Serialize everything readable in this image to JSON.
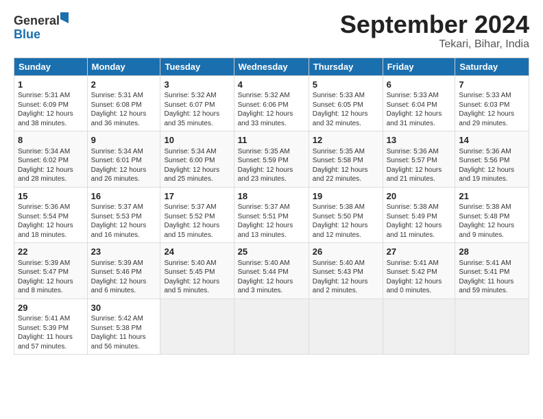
{
  "header": {
    "logo_general": "General",
    "logo_blue": "Blue",
    "title": "September 2024",
    "subtitle": "Tekari, Bihar, India"
  },
  "days_of_week": [
    "Sunday",
    "Monday",
    "Tuesday",
    "Wednesday",
    "Thursday",
    "Friday",
    "Saturday"
  ],
  "weeks": [
    [
      {
        "day": "1",
        "sunrise": "Sunrise: 5:31 AM",
        "sunset": "Sunset: 6:09 PM",
        "daylight": "Daylight: 12 hours and 38 minutes."
      },
      {
        "day": "2",
        "sunrise": "Sunrise: 5:31 AM",
        "sunset": "Sunset: 6:08 PM",
        "daylight": "Daylight: 12 hours and 36 minutes."
      },
      {
        "day": "3",
        "sunrise": "Sunrise: 5:32 AM",
        "sunset": "Sunset: 6:07 PM",
        "daylight": "Daylight: 12 hours and 35 minutes."
      },
      {
        "day": "4",
        "sunrise": "Sunrise: 5:32 AM",
        "sunset": "Sunset: 6:06 PM",
        "daylight": "Daylight: 12 hours and 33 minutes."
      },
      {
        "day": "5",
        "sunrise": "Sunrise: 5:33 AM",
        "sunset": "Sunset: 6:05 PM",
        "daylight": "Daylight: 12 hours and 32 minutes."
      },
      {
        "day": "6",
        "sunrise": "Sunrise: 5:33 AM",
        "sunset": "Sunset: 6:04 PM",
        "daylight": "Daylight: 12 hours and 31 minutes."
      },
      {
        "day": "7",
        "sunrise": "Sunrise: 5:33 AM",
        "sunset": "Sunset: 6:03 PM",
        "daylight": "Daylight: 12 hours and 29 minutes."
      }
    ],
    [
      {
        "day": "8",
        "sunrise": "Sunrise: 5:34 AM",
        "sunset": "Sunset: 6:02 PM",
        "daylight": "Daylight: 12 hours and 28 minutes."
      },
      {
        "day": "9",
        "sunrise": "Sunrise: 5:34 AM",
        "sunset": "Sunset: 6:01 PM",
        "daylight": "Daylight: 12 hours and 26 minutes."
      },
      {
        "day": "10",
        "sunrise": "Sunrise: 5:34 AM",
        "sunset": "Sunset: 6:00 PM",
        "daylight": "Daylight: 12 hours and 25 minutes."
      },
      {
        "day": "11",
        "sunrise": "Sunrise: 5:35 AM",
        "sunset": "Sunset: 5:59 PM",
        "daylight": "Daylight: 12 hours and 23 minutes."
      },
      {
        "day": "12",
        "sunrise": "Sunrise: 5:35 AM",
        "sunset": "Sunset: 5:58 PM",
        "daylight": "Daylight: 12 hours and 22 minutes."
      },
      {
        "day": "13",
        "sunrise": "Sunrise: 5:36 AM",
        "sunset": "Sunset: 5:57 PM",
        "daylight": "Daylight: 12 hours and 21 minutes."
      },
      {
        "day": "14",
        "sunrise": "Sunrise: 5:36 AM",
        "sunset": "Sunset: 5:56 PM",
        "daylight": "Daylight: 12 hours and 19 minutes."
      }
    ],
    [
      {
        "day": "15",
        "sunrise": "Sunrise: 5:36 AM",
        "sunset": "Sunset: 5:54 PM",
        "daylight": "Daylight: 12 hours and 18 minutes."
      },
      {
        "day": "16",
        "sunrise": "Sunrise: 5:37 AM",
        "sunset": "Sunset: 5:53 PM",
        "daylight": "Daylight: 12 hours and 16 minutes."
      },
      {
        "day": "17",
        "sunrise": "Sunrise: 5:37 AM",
        "sunset": "Sunset: 5:52 PM",
        "daylight": "Daylight: 12 hours and 15 minutes."
      },
      {
        "day": "18",
        "sunrise": "Sunrise: 5:37 AM",
        "sunset": "Sunset: 5:51 PM",
        "daylight": "Daylight: 12 hours and 13 minutes."
      },
      {
        "day": "19",
        "sunrise": "Sunrise: 5:38 AM",
        "sunset": "Sunset: 5:50 PM",
        "daylight": "Daylight: 12 hours and 12 minutes."
      },
      {
        "day": "20",
        "sunrise": "Sunrise: 5:38 AM",
        "sunset": "Sunset: 5:49 PM",
        "daylight": "Daylight: 12 hours and 11 minutes."
      },
      {
        "day": "21",
        "sunrise": "Sunrise: 5:38 AM",
        "sunset": "Sunset: 5:48 PM",
        "daylight": "Daylight: 12 hours and 9 minutes."
      }
    ],
    [
      {
        "day": "22",
        "sunrise": "Sunrise: 5:39 AM",
        "sunset": "Sunset: 5:47 PM",
        "daylight": "Daylight: 12 hours and 8 minutes."
      },
      {
        "day": "23",
        "sunrise": "Sunrise: 5:39 AM",
        "sunset": "Sunset: 5:46 PM",
        "daylight": "Daylight: 12 hours and 6 minutes."
      },
      {
        "day": "24",
        "sunrise": "Sunrise: 5:40 AM",
        "sunset": "Sunset: 5:45 PM",
        "daylight": "Daylight: 12 hours and 5 minutes."
      },
      {
        "day": "25",
        "sunrise": "Sunrise: 5:40 AM",
        "sunset": "Sunset: 5:44 PM",
        "daylight": "Daylight: 12 hours and 3 minutes."
      },
      {
        "day": "26",
        "sunrise": "Sunrise: 5:40 AM",
        "sunset": "Sunset: 5:43 PM",
        "daylight": "Daylight: 12 hours and 2 minutes."
      },
      {
        "day": "27",
        "sunrise": "Sunrise: 5:41 AM",
        "sunset": "Sunset: 5:42 PM",
        "daylight": "Daylight: 12 hours and 0 minutes."
      },
      {
        "day": "28",
        "sunrise": "Sunrise: 5:41 AM",
        "sunset": "Sunset: 5:41 PM",
        "daylight": "Daylight: 11 hours and 59 minutes."
      }
    ],
    [
      {
        "day": "29",
        "sunrise": "Sunrise: 5:41 AM",
        "sunset": "Sunset: 5:39 PM",
        "daylight": "Daylight: 11 hours and 57 minutes."
      },
      {
        "day": "30",
        "sunrise": "Sunrise: 5:42 AM",
        "sunset": "Sunset: 5:38 PM",
        "daylight": "Daylight: 11 hours and 56 minutes."
      },
      null,
      null,
      null,
      null,
      null
    ]
  ]
}
